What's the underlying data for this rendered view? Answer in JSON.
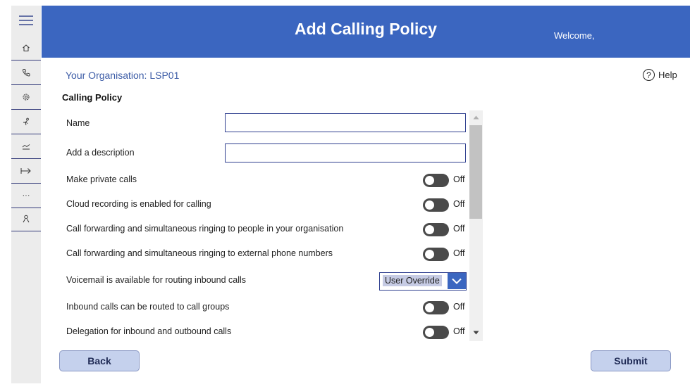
{
  "header": {
    "title": "Add Calling Policy",
    "welcome": "Welcome,"
  },
  "organisation": {
    "label": "Your Organisation: LSP01"
  },
  "help": {
    "label": "Help",
    "glyph": "?"
  },
  "section_title": "Calling Policy",
  "nav": {
    "icons": [
      "menu-icon",
      "home-icon",
      "phone-icon",
      "settings-icon",
      "org-chart-icon",
      "analytics-icon",
      "exit-icon",
      "more-icon",
      "user-icon"
    ],
    "more_glyph": "···"
  },
  "form": {
    "name_label": "Name",
    "name_value": "",
    "description_label": "Add a description",
    "description_value": "",
    "toggles": [
      {
        "label": "Make private calls",
        "state": "Off"
      },
      {
        "label": "Cloud recording is enabled for calling",
        "state": "Off"
      },
      {
        "label": "Call forwarding and simultaneous ringing to people in your organisation",
        "state": "Off"
      },
      {
        "label": "Call forwarding and simultaneous ringing to external phone numbers",
        "state": "Off"
      },
      {
        "label": "Inbound calls can be routed to call groups",
        "state": "Off"
      },
      {
        "label": "Delegation for inbound and outbound calls",
        "state": "Off"
      }
    ],
    "voicemail": {
      "label": "Voicemail is available for routing inbound calls",
      "value": "User Override"
    }
  },
  "buttons": {
    "back": "Back",
    "submit": "Submit"
  },
  "colors": {
    "header": "#3b66c0",
    "accent": "#2f3f8f",
    "rail": "#ececec",
    "toggle_off": "#4a4a4a",
    "button": "#c5d1ed"
  }
}
